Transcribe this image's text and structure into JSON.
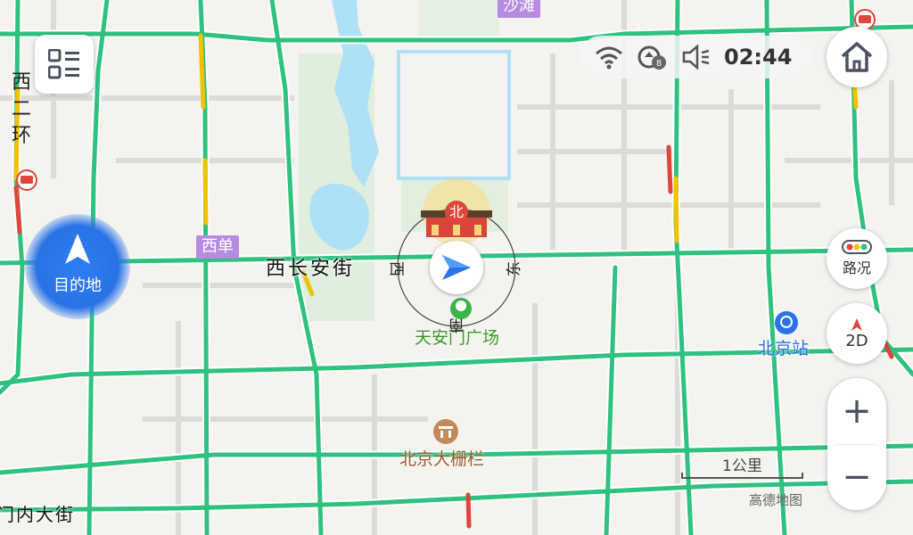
{
  "status_bar": {
    "time": "02:44",
    "wifi_icon": "wifi-icon",
    "signal_icon": "signal-icon",
    "sound_icon": "speaker-icon"
  },
  "map_labels": {
    "shatan": "沙滩",
    "xidan": "西单",
    "west_2nd_ring": [
      "西",
      "二",
      "环"
    ],
    "chang_an": "西长安街",
    "tiananmen_square": "天安门广场",
    "beijing_station": "北京站",
    "dashilan": "北京大栅栏",
    "street_bottom_left": "门内大街"
  },
  "compass": {
    "north": "北",
    "south": "南",
    "east": "东",
    "west": "西"
  },
  "buttons": {
    "menu": "menu-icon",
    "home": "home-icon",
    "destination": "目的地",
    "traffic": "路况",
    "view_mode": "2D",
    "zoom_in": "+",
    "zoom_out": "−"
  },
  "scale": {
    "label": "1公里"
  },
  "attribution": "高德地图",
  "colors": {
    "road_traffic_green": "#2ec27e",
    "road_slow_yellow": "#f2c200",
    "road_jam_red": "#e0443a",
    "accent_blue": "#2a72e6"
  }
}
